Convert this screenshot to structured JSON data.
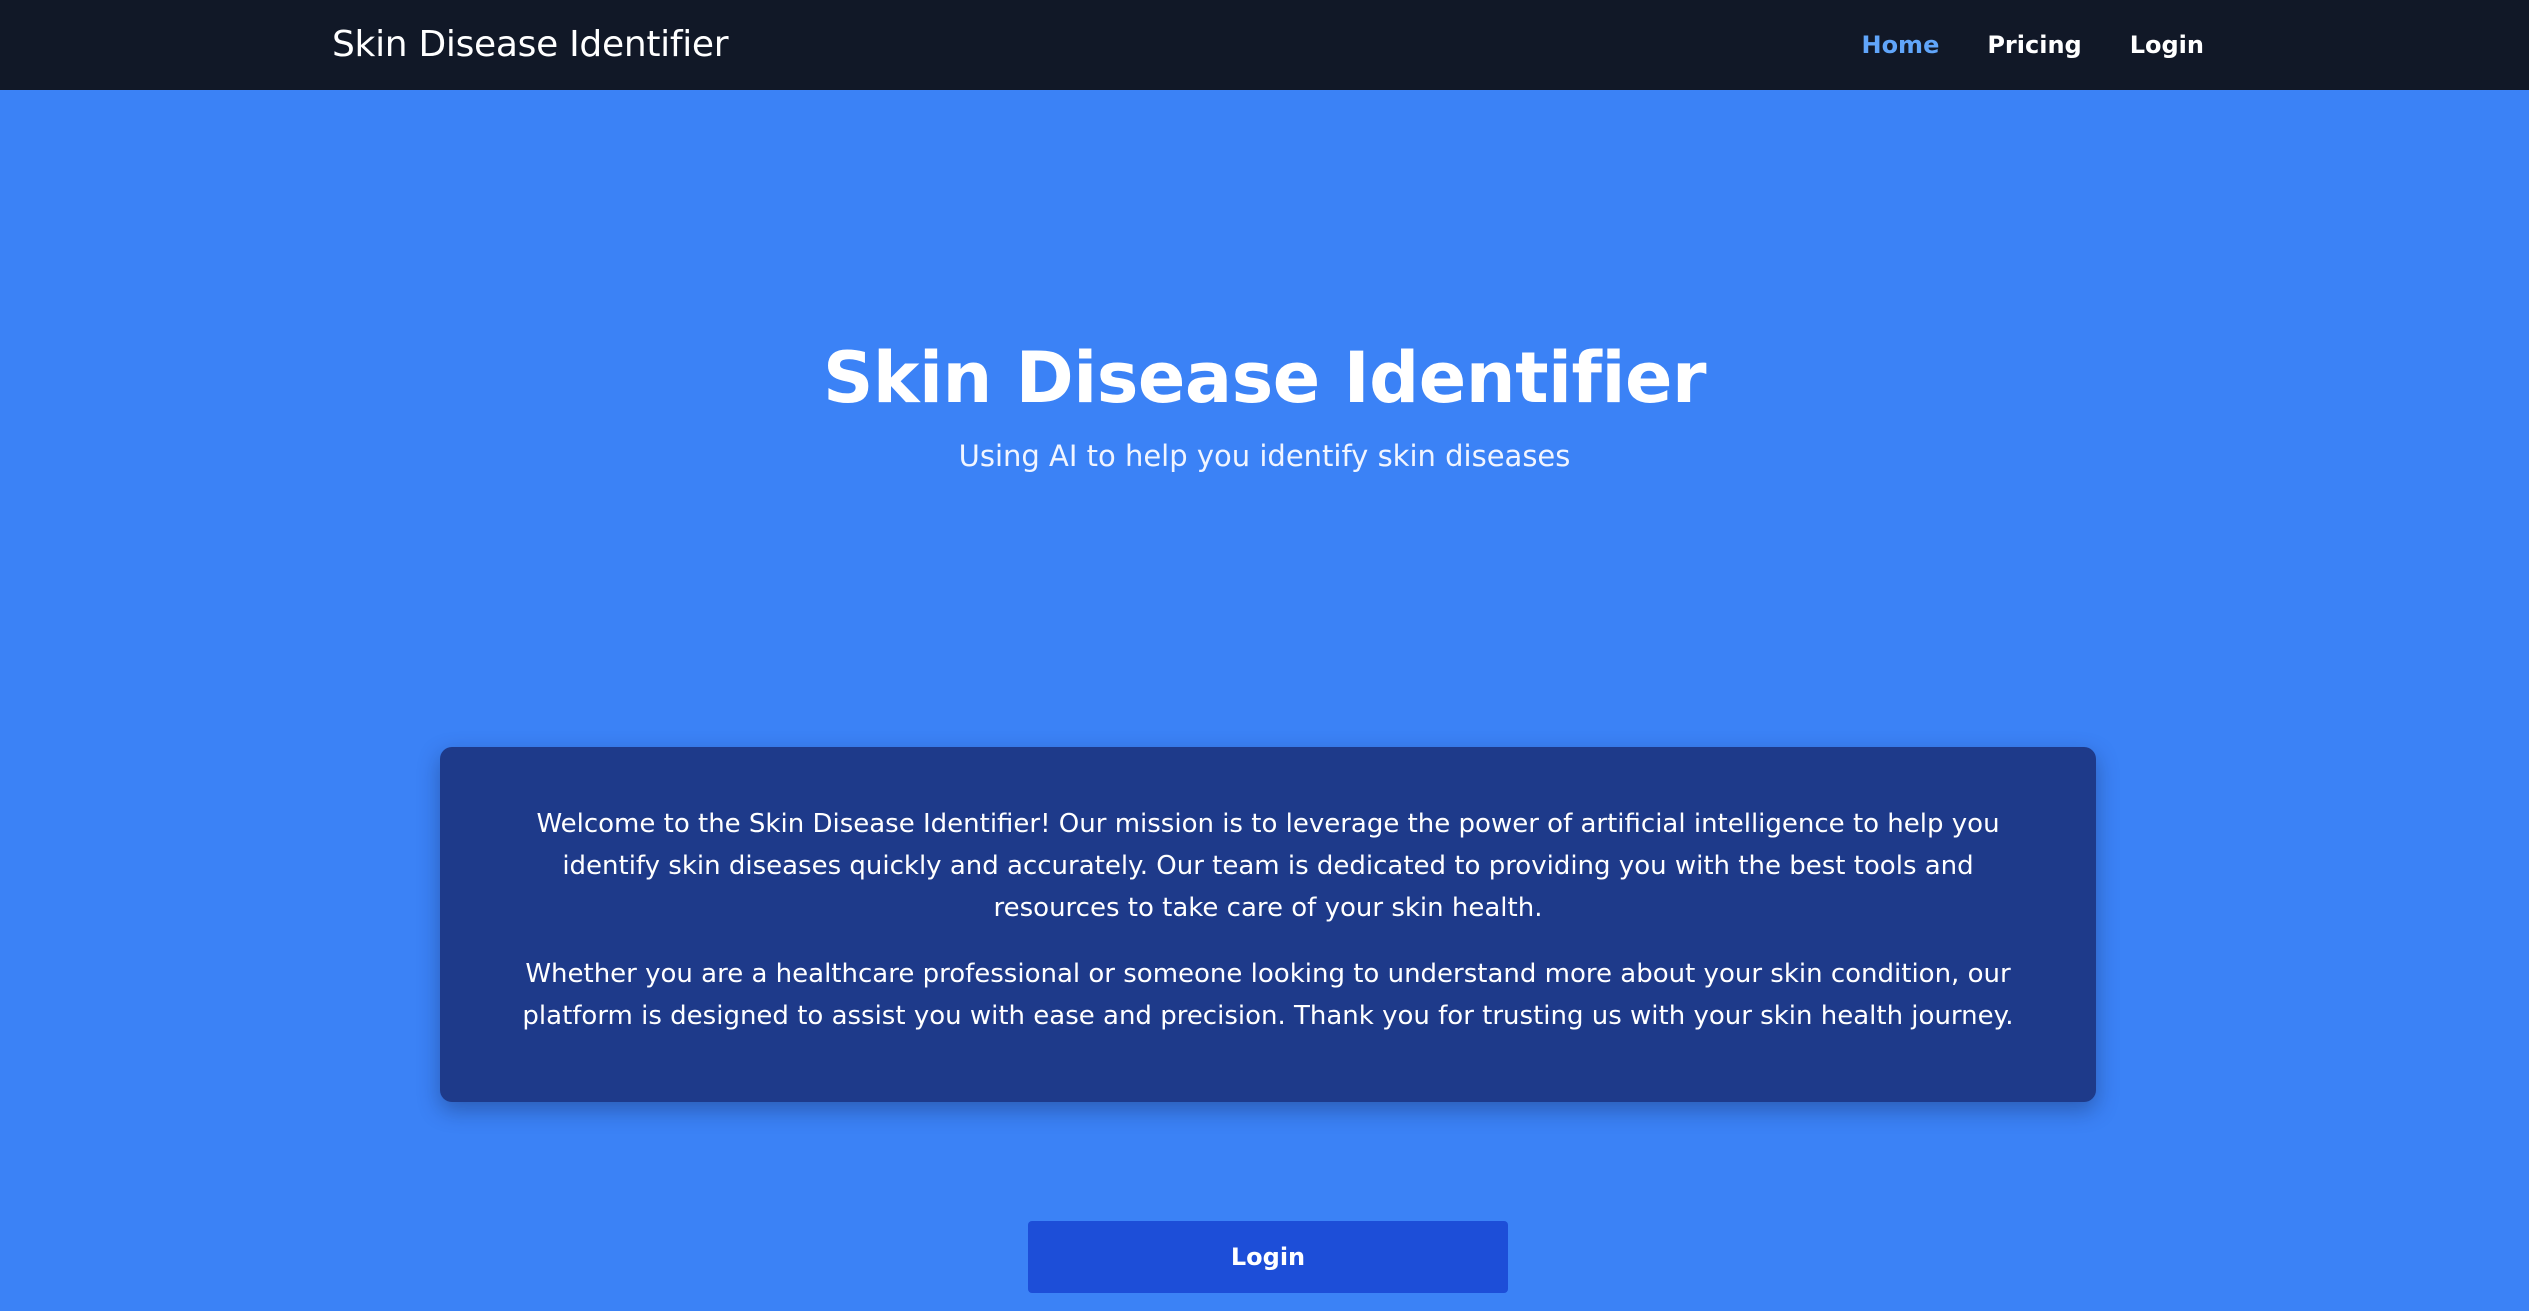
{
  "navbar": {
    "brand": "Skin Disease Identifier",
    "links": [
      {
        "label": "Home",
        "active": true
      },
      {
        "label": "Pricing",
        "active": false
      },
      {
        "label": "Login",
        "active": false
      }
    ]
  },
  "hero": {
    "title": "Skin Disease Identifier",
    "subtitle": "Using AI to help you identify skin diseases"
  },
  "about": {
    "paragraphs": [
      "Welcome to the Skin Disease Identifier! Our mission is to leverage the power of artificial intelligence to help you identify skin diseases quickly and accurately. Our team is dedicated to providing you with the best tools and resources to take care of your skin health.",
      "Whether you are a healthcare professional or someone looking to understand more about your skin condition, our platform is designed to assist you with ease and precision. Thank you for trusting us with your skin health journey."
    ]
  },
  "cta": {
    "login_label": "Login"
  },
  "colors": {
    "navbar_bg": "#111827",
    "page_bg": "#3b82f6",
    "card_bg": "#1e3a8a",
    "button_bg": "#1d4ed8",
    "active_link": "#60a5fa"
  }
}
